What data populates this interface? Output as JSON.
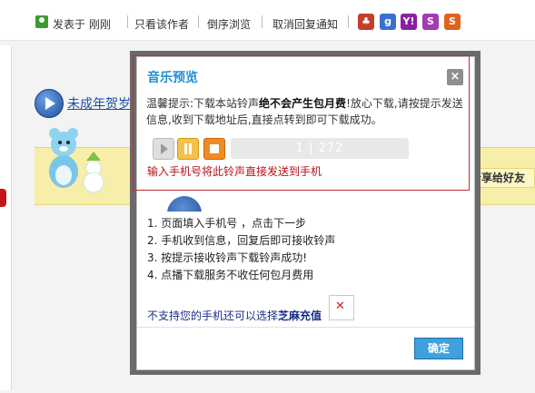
{
  "topbar": {
    "posted_by": "发表于",
    "posted_time": "刚刚",
    "only_author": "只看该作者",
    "reverse_view": "倒序浏览",
    "cancel_notify": "取消回复通知",
    "share_icons": [
      {
        "name": "baidu-icon",
        "glyph": "♣",
        "color": "#c2402b"
      },
      {
        "name": "google-icon",
        "glyph": "g",
        "color": "#3b6fd2"
      },
      {
        "name": "yahoo-icon",
        "glyph": "Y!",
        "color": "#8b1fa3"
      },
      {
        "name": "sohu-icon",
        "glyph": "S",
        "color": "#a53ab5"
      },
      {
        "name": "sina-icon",
        "glyph": "S",
        "color": "#e3601c"
      }
    ]
  },
  "page": {
    "new_year_link": "未成年贺岁朋",
    "share_friends": "分享给好友"
  },
  "dialog": {
    "title": "音乐预览",
    "close": "×",
    "notice_prefix": "温馨提示:下载本站铃声",
    "notice_bold": "绝不会产生包月费",
    "notice_suffix": "!放心下载,请按提示发送信息,收到下载地址后,直接点转到即可下载成功。",
    "progress_text": "1 | 272",
    "sms_link": "输入手机号将此铃声直接发送到手机",
    "steps": [
      "1. 页面填入手机号 ，点击下一步",
      "2. 手机收到信息，回复后即可接收铃声",
      "3. 按提示接收铃声下载铃声成功!",
      "4. 点播下载服务不收任何包月费用"
    ],
    "alt_prefix": "不支持您的手机还可以选择",
    "alt_bold": "芝麻充值",
    "ok_button": "确定"
  },
  "colors": {
    "title_blue": "#1f8fd4",
    "link_red": "#b4121a",
    "ok_blue": "#3fa0de"
  }
}
